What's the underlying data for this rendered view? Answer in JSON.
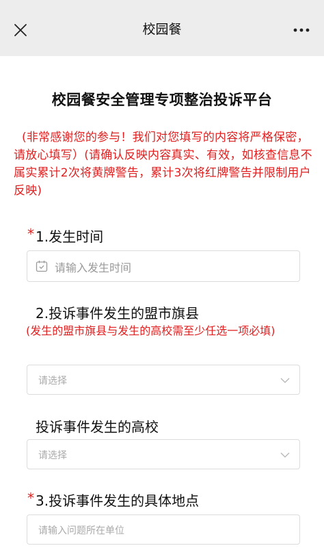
{
  "header": {
    "title": "校园餐"
  },
  "page": {
    "title": "校园餐安全管理专项整治投诉平台",
    "notice": "(非常感谢您的参与！我们对您填写的内容将严格保密，请放心填写）(请确认反映内容真实、有效，如核查信息不属实累计2次将黄牌警告，累计3次将红牌警告并限制用户反映)"
  },
  "form": {
    "q1": {
      "required_mark": "*",
      "label": "1.发生时间",
      "placeholder": "请输入发生时间"
    },
    "q2": {
      "label": "2.投诉事件发生的盟市旗县",
      "note": "(发生的盟市旗县与发生的高校需至少任选一项必填)",
      "placeholder": "请选择"
    },
    "q2b": {
      "label": "投诉事件发生的高校",
      "placeholder": "请选择"
    },
    "q3": {
      "required_mark": "*",
      "label": "3.投诉事件发生的具体地点",
      "placeholder": "请输入问题所在单位"
    }
  },
  "colors": {
    "accent_red": "#e02020",
    "navbar_bg": "#ededed"
  },
  "icons": [
    "close-icon",
    "more-icon",
    "calendar-icon",
    "chevron-down-icon"
  ]
}
